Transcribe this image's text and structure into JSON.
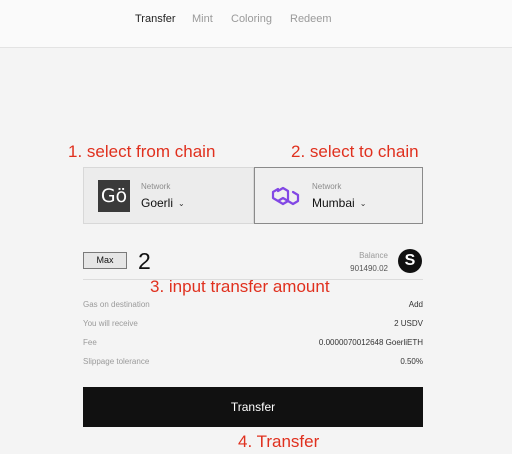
{
  "nav": {
    "tabs": [
      {
        "label": "Transfer",
        "active": true
      },
      {
        "label": "Mint",
        "active": false
      },
      {
        "label": "Coloring",
        "active": false
      },
      {
        "label": "Redeem",
        "active": false
      }
    ]
  },
  "annotations": {
    "step1": "1. select from chain",
    "step2": "2. select to chain",
    "step3": "3. input transfer amount",
    "step4": "4. Transfer",
    "color": "#e0301e"
  },
  "from_chain": {
    "label": "Network",
    "name": "Goerli",
    "logo_text": "Gö",
    "logo_icon": "goerli-logo",
    "dropdown_icon": "chevron-down-icon"
  },
  "to_chain": {
    "label": "Network",
    "name": "Mumbai",
    "logo_icon": "polygon-logo",
    "logo_color": "#8247e5",
    "dropdown_icon": "chevron-down-icon"
  },
  "amount": {
    "max_label": "Max",
    "value": "2",
    "balance_label": "Balance",
    "balance_value": "901490.02",
    "token_icon": "usdv-icon",
    "token_symbol": "S"
  },
  "details": [
    {
      "label": "Gas on destination",
      "value": "Add"
    },
    {
      "label": "You will receive",
      "value": "2 USDV"
    },
    {
      "label": "Fee",
      "value": "0.0000070012648 GoerliETH"
    },
    {
      "label": "Slippage tolerance",
      "value": "0.50%"
    }
  ],
  "transfer_button": {
    "label": "Transfer"
  }
}
